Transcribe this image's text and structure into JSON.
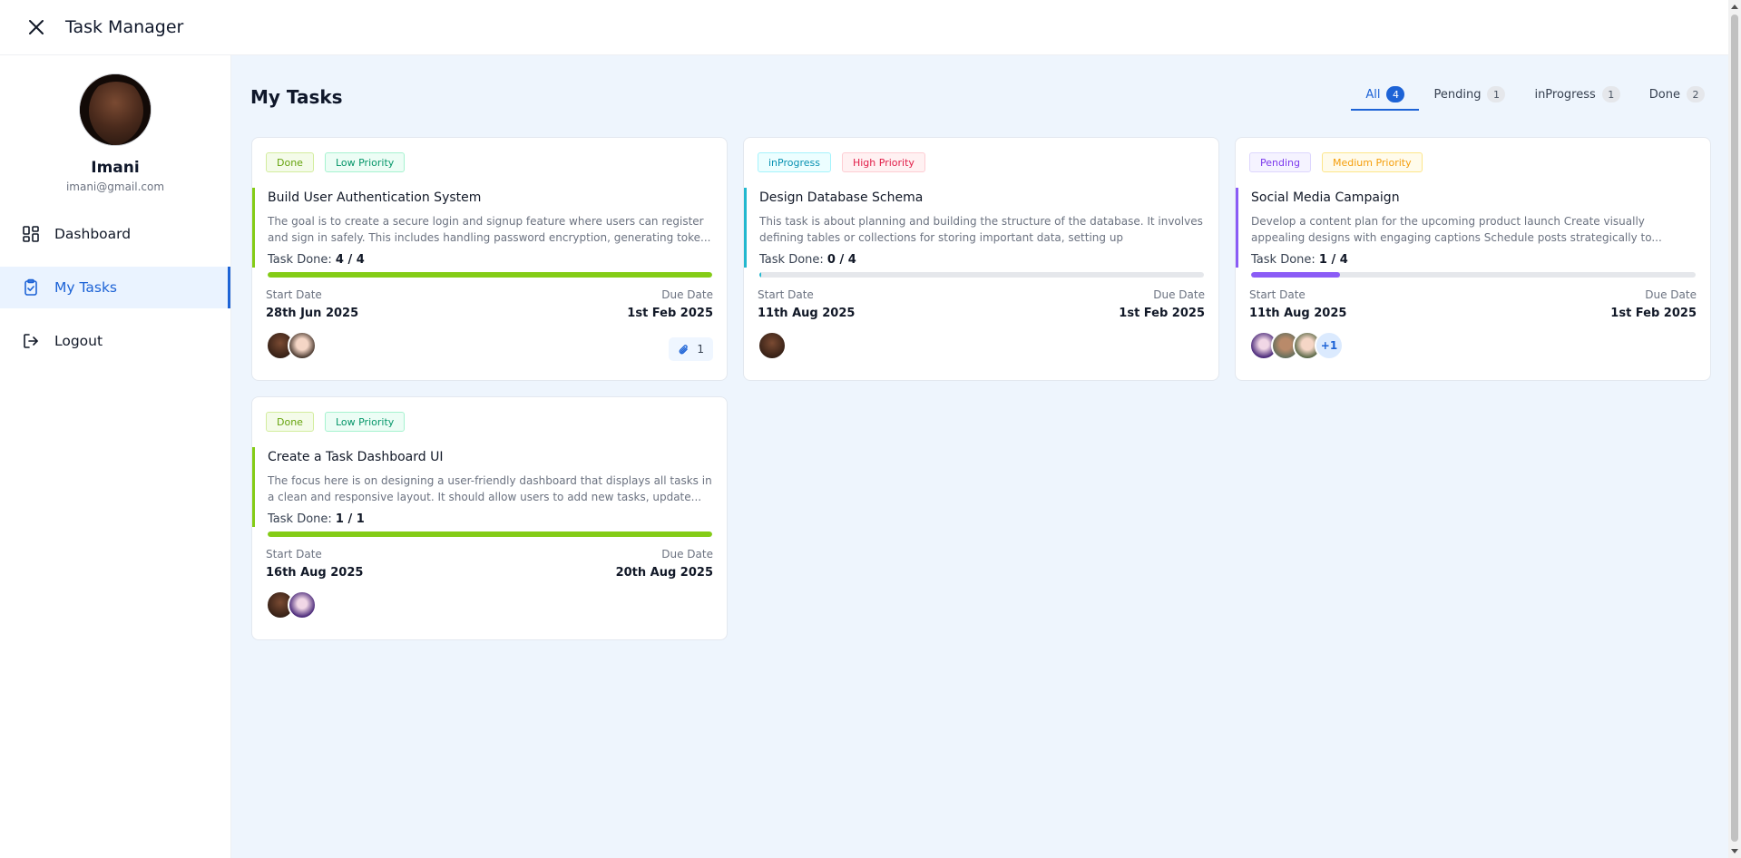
{
  "app": {
    "title": "Task Manager"
  },
  "profile": {
    "name": "Imani",
    "email": "imani@gmail.com"
  },
  "nav": [
    {
      "label": "Dashboard",
      "icon": "dashboard-icon"
    },
    {
      "label": "My Tasks",
      "icon": "clipboard-check-icon"
    },
    {
      "label": "Logout",
      "icon": "logout-icon"
    }
  ],
  "page": {
    "title": "My Tasks"
  },
  "tabs": [
    {
      "label": "All",
      "count": "4"
    },
    {
      "label": "Pending",
      "count": "1"
    },
    {
      "label": "inProgress",
      "count": "1"
    },
    {
      "label": "Done",
      "count": "2"
    }
  ],
  "tasks": [
    {
      "status": "Done",
      "priority": "Low Priority",
      "title": "Build User Authentication System",
      "description": "The goal is to create a secure login and signup feature where users can register and sign in safely. This includes handling password encryption, generating toke...",
      "task_done_label": "Task Done:",
      "task_done": "4 / 4",
      "progress": 1.0,
      "start_label": "Start Date",
      "start": "28th Jun 2025",
      "due_label": "Due Date",
      "due": "1st Feb 2025",
      "attachments": "1",
      "accent": "#84cc16"
    },
    {
      "status": "inProgress",
      "priority": "High Priority",
      "title": "Design Database Schema",
      "description": "This task is about planning and building the structure of the database. It involves defining tables or collections for storing important data, setting up relationships...",
      "task_done_label": "Task Done:",
      "task_done": "0 / 4",
      "progress": 0.0,
      "start_label": "Start Date",
      "start": "11th Aug 2025",
      "due_label": "Due Date",
      "due": "1st Feb 2025",
      "accent": "#22b8cf"
    },
    {
      "status": "Pending",
      "priority": "Medium Priority",
      "title": "Social Media Campaign",
      "description": "Develop a content plan for the upcoming product launch Create visually appealing designs with engaging captions Schedule posts strategically to...",
      "task_done_label": "Task Done:",
      "task_done": "1 / 4",
      "progress": 0.2,
      "start_label": "Start Date",
      "start": "11th Aug 2025",
      "due_label": "Due Date",
      "due": "1st Feb 2025",
      "extra_assignees": "+1",
      "accent": "#8b5cf6"
    },
    {
      "status": "Done",
      "priority": "Low Priority",
      "title": "Create a Task Dashboard UI",
      "description": "The focus here is on designing a user-friendly dashboard that displays all tasks in a clean and responsive layout. It should allow users to add new tasks, update...",
      "task_done_label": "Task Done:",
      "task_done": "1 / 1",
      "progress": 1.0,
      "start_label": "Start Date",
      "start": "16th Aug 2025",
      "due_label": "Due Date",
      "due": "20th Aug 2025",
      "accent": "#84cc16"
    }
  ]
}
